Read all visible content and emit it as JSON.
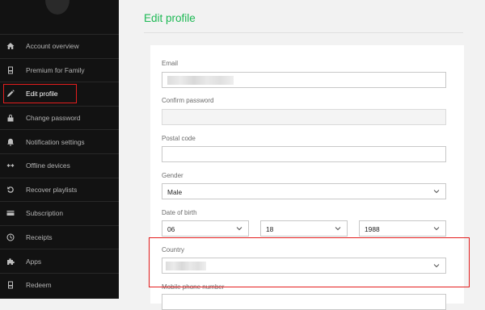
{
  "sidebar": {
    "items": [
      {
        "label": "Account overview",
        "icon": "home-icon"
      },
      {
        "label": "Premium for Family",
        "icon": "device-icon"
      },
      {
        "label": "Edit profile",
        "icon": "pencil-icon",
        "active": true
      },
      {
        "label": "Change password",
        "icon": "lock-icon"
      },
      {
        "label": "Notification settings",
        "icon": "bell-icon"
      },
      {
        "label": "Offline devices",
        "icon": "arrows-icon"
      },
      {
        "label": "Recover playlists",
        "icon": "recover-icon"
      },
      {
        "label": "Subscription",
        "icon": "card-icon"
      },
      {
        "label": "Receipts",
        "icon": "clock-icon"
      },
      {
        "label": "Apps",
        "icon": "puzzle-icon"
      },
      {
        "label": "Redeem",
        "icon": "device-icon"
      }
    ]
  },
  "main": {
    "title": "Edit profile",
    "fields": {
      "email": {
        "label": "Email",
        "value": ""
      },
      "confirm_password": {
        "label": "Confirm password",
        "value": ""
      },
      "postal_code": {
        "label": "Postal code",
        "value": ""
      },
      "gender": {
        "label": "Gender",
        "value": "Male"
      },
      "dob": {
        "label": "Date of birth",
        "month": "06",
        "day": "18",
        "year": "1988"
      },
      "country": {
        "label": "Country",
        "value": ""
      },
      "mobile": {
        "label": "Mobile phone number"
      }
    }
  },
  "colors": {
    "sidebar_bg": "#121212",
    "accent_green": "#1db954",
    "highlight_red": "#e41e1e"
  }
}
